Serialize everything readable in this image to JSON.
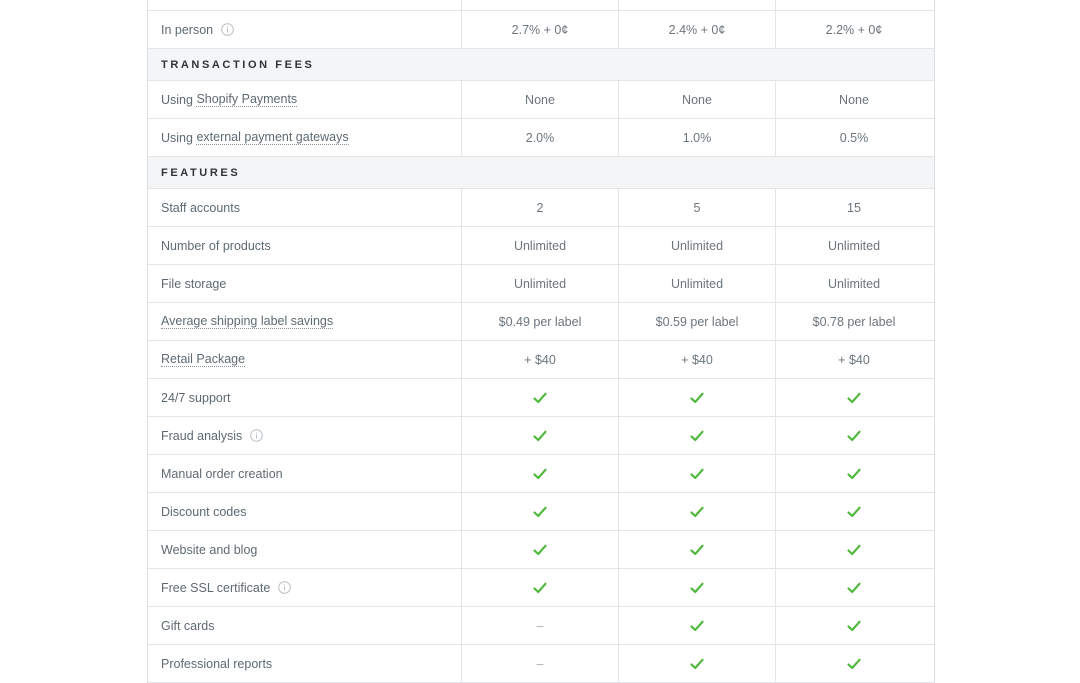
{
  "partial_row": {
    "cells": [
      "",
      "",
      ""
    ]
  },
  "rows_top": [
    {
      "label": "In person",
      "info": true,
      "values": [
        "2.7% + 0¢",
        "2.4% + 0¢",
        "2.2% + 0¢"
      ]
    }
  ],
  "transaction_fees": {
    "heading": "TRANSACTION FEES",
    "rows": [
      {
        "prefix": "Using ",
        "link": "Shopify Payments",
        "values": [
          "None",
          "None",
          "None"
        ]
      },
      {
        "prefix": "Using ",
        "link": "external payment gateways",
        "values": [
          "2.0%",
          "1.0%",
          "0.5%"
        ]
      }
    ]
  },
  "features": {
    "heading": "FEATURES",
    "text_rows": [
      {
        "label": "Staff accounts",
        "values": [
          "2",
          "5",
          "15"
        ]
      },
      {
        "label": "Number of products",
        "values": [
          "Unlimited",
          "Unlimited",
          "Unlimited"
        ]
      },
      {
        "label": "File storage",
        "values": [
          "Unlimited",
          "Unlimited",
          "Unlimited"
        ]
      },
      {
        "label": "Average shipping label savings",
        "link": true,
        "values": [
          "$0.49 per label",
          "$0.59 per label",
          "$0.78 per label"
        ]
      },
      {
        "label": "Retail Package",
        "link": true,
        "values": [
          "+ $40",
          "+ $40",
          "+ $40"
        ]
      }
    ],
    "check_rows": [
      {
        "label": "24/7 support",
        "info": false,
        "values": [
          true,
          true,
          true
        ]
      },
      {
        "label": "Fraud analysis",
        "info": true,
        "values": [
          true,
          true,
          true
        ]
      },
      {
        "label": "Manual order creation",
        "info": false,
        "values": [
          true,
          true,
          true
        ]
      },
      {
        "label": "Discount codes",
        "info": false,
        "values": [
          true,
          true,
          true
        ]
      },
      {
        "label": "Website and blog",
        "info": false,
        "values": [
          true,
          true,
          true
        ]
      },
      {
        "label": "Free SSL certificate",
        "info": true,
        "values": [
          true,
          true,
          true
        ]
      },
      {
        "label": "Gift cards",
        "info": false,
        "values": [
          false,
          true,
          true
        ]
      },
      {
        "label": "Professional reports",
        "info": false,
        "values": [
          false,
          true,
          true
        ]
      }
    ],
    "dash": "–"
  },
  "colors": {
    "check": "#50b83c",
    "section_bg": "#f4f5f6",
    "border": "#e3e5e7"
  }
}
